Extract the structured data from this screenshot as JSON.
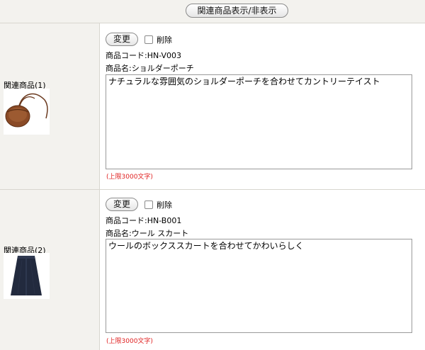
{
  "header": {
    "toggle_label": "関連商品表示/非表示"
  },
  "products": [
    {
      "label": "関連商品(1)",
      "thumbnail_icon": "shoulder-bag-image",
      "change_label": "変更",
      "delete_label": "削除",
      "code_line": "商品コード:HN-V003",
      "name_line": "商品名:ショルダーポーチ",
      "description": "ナチュラルな雰囲気のショルダーポーチを合わせてカントリーテイスト",
      "limit_note": "(上限3000文字)"
    },
    {
      "label": "関連商品(2)",
      "thumbnail_icon": "skirt-image",
      "change_label": "変更",
      "delete_label": "削除",
      "code_line": "商品コード:HN-B001",
      "name_line": "商品名:ウール スカート",
      "description": "ウールのボックススカートを合わせてかわいらしく",
      "limit_note": "(上限3000文字)"
    }
  ]
}
